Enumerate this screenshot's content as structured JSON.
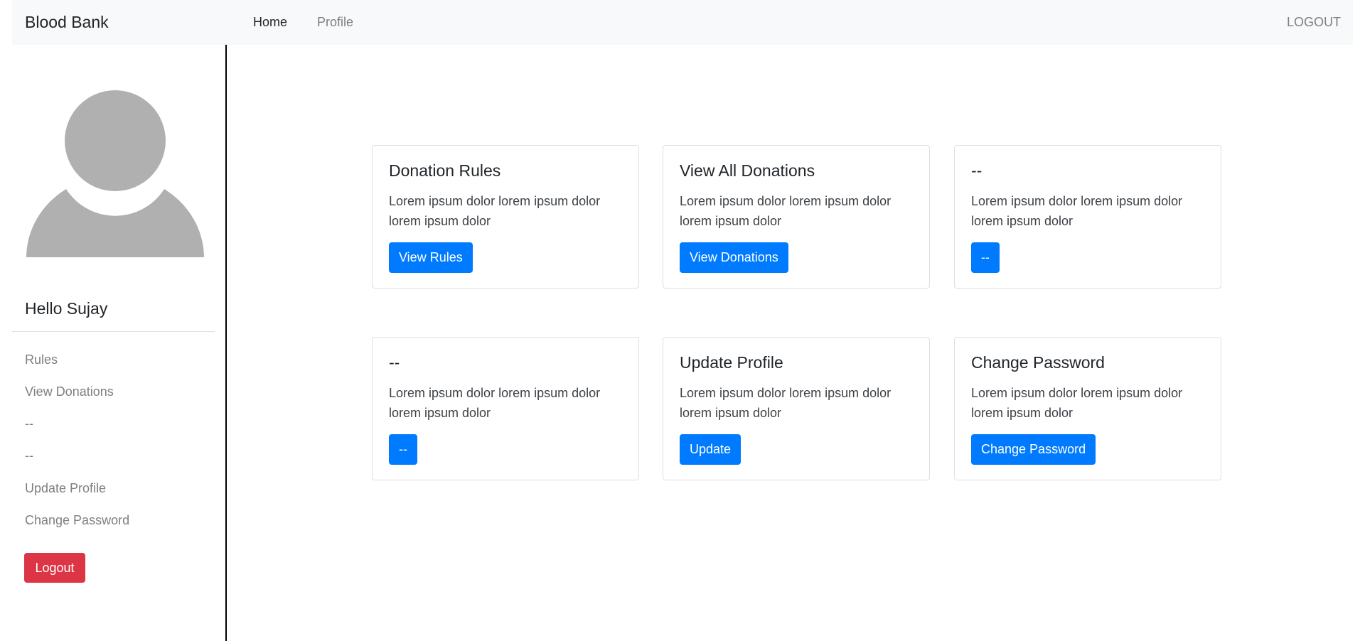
{
  "navbar": {
    "brand": "Blood Bank",
    "links": [
      "Home",
      "Profile"
    ],
    "logout": "LOGOUT"
  },
  "sidebar": {
    "greeting": "Hello Sujay",
    "items": [
      "Rules",
      "View Donations",
      "--",
      "--",
      "Update Profile",
      "Change Password"
    ],
    "logout_button": "Logout",
    "avatar_icon": "user-avatar-icon"
  },
  "cards": [
    {
      "title": "Donation Rules",
      "text": "Lorem ipsum dolor lorem ipsum dolor lorem ipsum dolor",
      "button": "View Rules"
    },
    {
      "title": "View All Donations",
      "text": "Lorem ipsum dolor lorem ipsum dolor lorem ipsum dolor",
      "button": "View Donations"
    },
    {
      "title": "--",
      "text": "Lorem ipsum dolor lorem ipsum dolor lorem ipsum dolor",
      "button": "--"
    },
    {
      "title": "--",
      "text": "Lorem ipsum dolor lorem ipsum dolor lorem ipsum dolor",
      "button": "--"
    },
    {
      "title": "Update Profile",
      "text": "Lorem ipsum dolor lorem ipsum dolor lorem ipsum dolor",
      "button": "Update"
    },
    {
      "title": "Change Password",
      "text": "Lorem ipsum dolor lorem ipsum dolor lorem ipsum dolor",
      "button": "Change Password"
    }
  ],
  "colors": {
    "primary": "#007bff",
    "danger": "#dc3545",
    "navbar_bg": "#f8f9fa",
    "avatar": "#b1b0b0"
  }
}
